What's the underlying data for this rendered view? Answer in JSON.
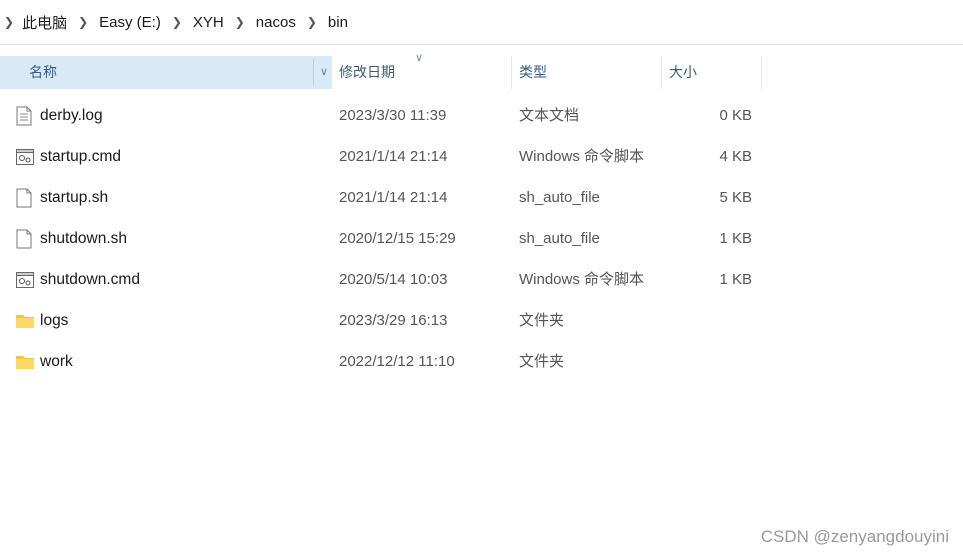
{
  "breadcrumb": {
    "items": [
      "此电脑",
      "Easy (E:)",
      "XYH",
      "nacos",
      "bin"
    ]
  },
  "columns": {
    "name": "名称",
    "date": "修改日期",
    "type": "类型",
    "size": "大小"
  },
  "files": [
    {
      "name": "derby.log",
      "date": "2023/3/30 11:39",
      "type": "文本文档",
      "size": "0 KB",
      "icon": "text-file-icon"
    },
    {
      "name": "startup.cmd",
      "date": "2021/1/14 21:14",
      "type": "Windows 命令脚本",
      "size": "4 KB",
      "icon": "script-file-icon"
    },
    {
      "name": "startup.sh",
      "date": "2021/1/14 21:14",
      "type": "sh_auto_file",
      "size": "5 KB",
      "icon": "blank-file-icon"
    },
    {
      "name": "shutdown.sh",
      "date": "2020/12/15 15:29",
      "type": "sh_auto_file",
      "size": "1 KB",
      "icon": "blank-file-icon"
    },
    {
      "name": "shutdown.cmd",
      "date": "2020/5/14 10:03",
      "type": "Windows 命令脚本",
      "size": "1 KB",
      "icon": "script-file-icon"
    },
    {
      "name": "logs",
      "date": "2023/3/29 16:13",
      "type": "文件夹",
      "size": "",
      "icon": "folder-icon"
    },
    {
      "name": "work",
      "date": "2022/12/12 11:10",
      "type": "文件夹",
      "size": "",
      "icon": "folder-icon"
    }
  ],
  "watermark": "CSDN @zenyangdouyini"
}
